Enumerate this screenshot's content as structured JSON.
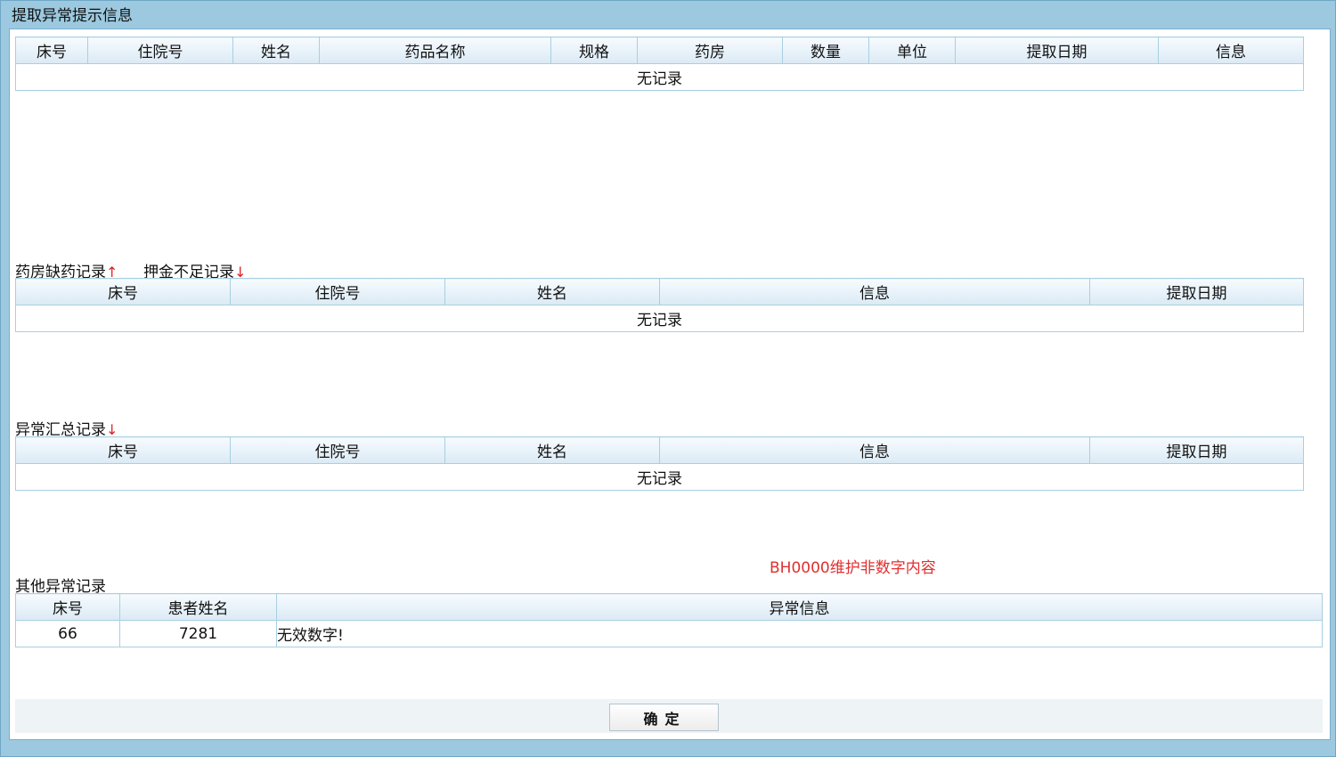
{
  "window": {
    "title": "提取异常提示信息"
  },
  "extract_table": {
    "columns": [
      "床号",
      "住院号",
      "姓名",
      "药品名称",
      "规格",
      "药房",
      "数量",
      "单位",
      "提取日期",
      "信息"
    ],
    "empty_text": "无记录"
  },
  "toggles": {
    "pharmacy_shortage_label": "药房缺药记录",
    "pharmacy_shortage_arrow": "↑",
    "deposit_shortage_label": "押金不足记录",
    "deposit_shortage_arrow": "↓"
  },
  "pharmacy_table": {
    "columns": [
      "床号",
      "住院号",
      "姓名",
      "信息",
      "提取日期"
    ],
    "empty_text": "无记录"
  },
  "summary": {
    "label": "异常汇总记录",
    "arrow": "↓"
  },
  "summary_table": {
    "columns": [
      "床号",
      "住院号",
      "姓名",
      "信息",
      "提取日期"
    ],
    "empty_text": "无记录"
  },
  "warning_text": "BH0000维护非数字内容",
  "other": {
    "label": "其他异常记录",
    "columns": [
      "床号",
      "患者姓名",
      "异常信息"
    ],
    "rows": [
      {
        "bed": "66",
        "patient": "7281",
        "info": "无效数字!"
      }
    ]
  },
  "footer": {
    "ok_label": "确定"
  },
  "colors": {
    "accent": "#9cc9df",
    "warning": "#e03030",
    "arrow": "#e02020"
  }
}
